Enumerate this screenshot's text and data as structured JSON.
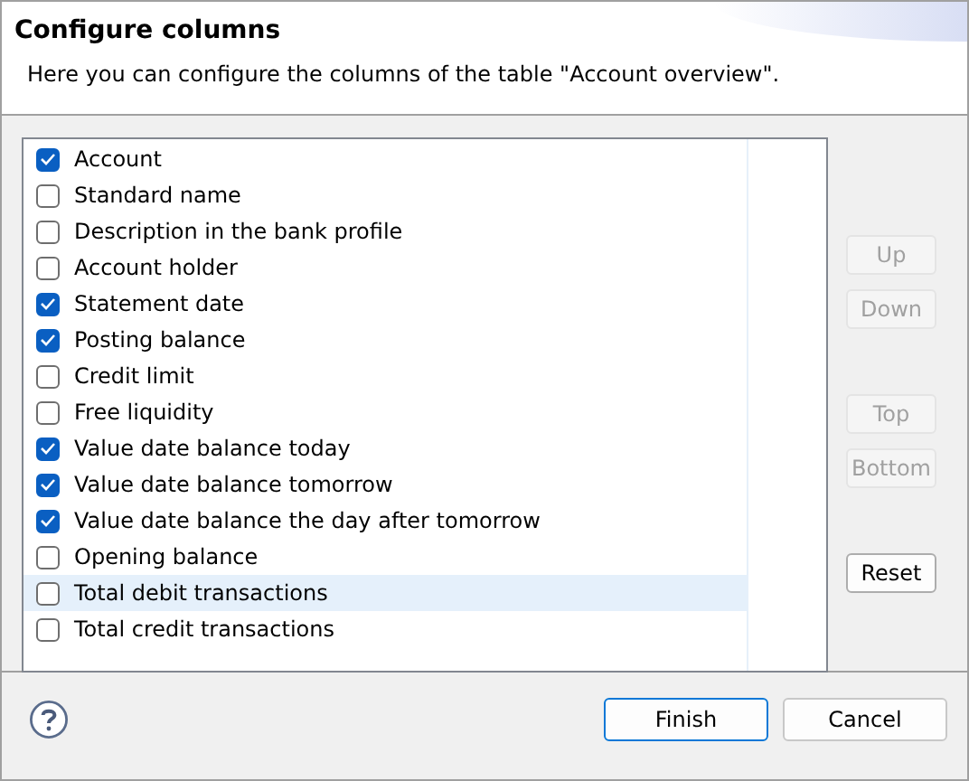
{
  "header": {
    "title": "Configure columns",
    "description": "Here you can configure the columns of the table \"Account overview\"."
  },
  "columns": [
    {
      "label": "Account",
      "checked": true,
      "selected": false
    },
    {
      "label": "Standard name",
      "checked": false,
      "selected": false
    },
    {
      "label": "Description in the bank profile",
      "checked": false,
      "selected": false
    },
    {
      "label": "Account holder",
      "checked": false,
      "selected": false
    },
    {
      "label": "Statement date",
      "checked": true,
      "selected": false
    },
    {
      "label": "Posting balance",
      "checked": true,
      "selected": false
    },
    {
      "label": "Credit limit",
      "checked": false,
      "selected": false
    },
    {
      "label": "Free liquidity",
      "checked": false,
      "selected": false
    },
    {
      "label": "Value date balance today",
      "checked": true,
      "selected": false
    },
    {
      "label": "Value date balance tomorrow",
      "checked": true,
      "selected": false
    },
    {
      "label": "Value date balance the day after tomorrow",
      "checked": true,
      "selected": false
    },
    {
      "label": "Opening balance",
      "checked": false,
      "selected": false
    },
    {
      "label": "Total debit transactions",
      "checked": false,
      "selected": true
    },
    {
      "label": "Total credit transactions",
      "checked": false,
      "selected": false
    }
  ],
  "side_button_groups": [
    [
      {
        "label": "Up",
        "disabled": true
      },
      {
        "label": "Down",
        "disabled": true
      }
    ],
    [
      {
        "label": "Top",
        "disabled": true
      },
      {
        "label": "Bottom",
        "disabled": true
      }
    ],
    [
      {
        "label": "Reset",
        "disabled": false
      }
    ]
  ],
  "footer_buttons": [
    {
      "label": "Finish",
      "default": true
    },
    {
      "label": "Cancel",
      "default": false
    }
  ]
}
